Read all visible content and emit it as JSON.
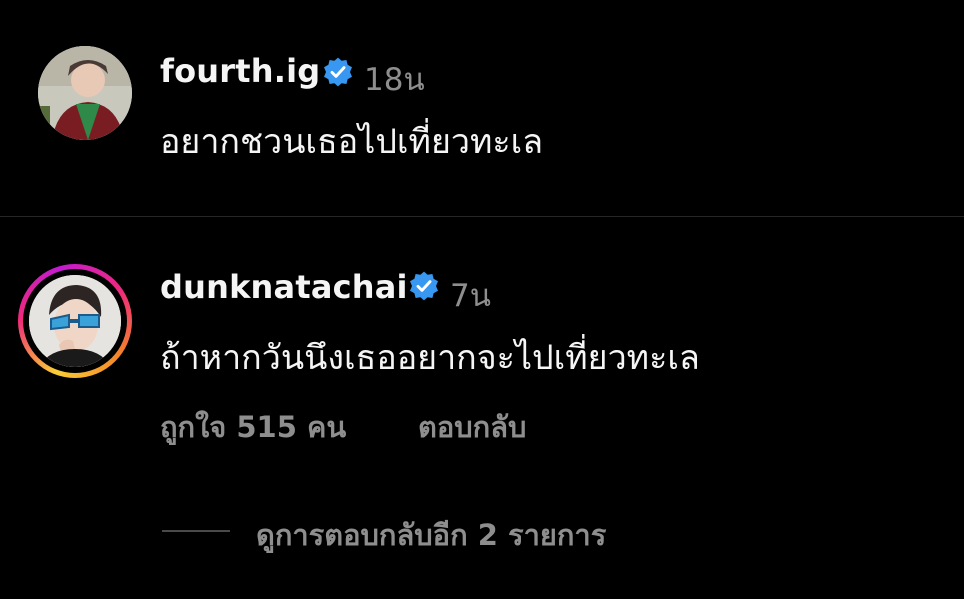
{
  "comments": [
    {
      "username": "fourth.ig",
      "verified": true,
      "time": "18น",
      "text": "อยากชวนเธอไปเที่ยวทะเล",
      "avatar_story_ring": false
    },
    {
      "username": "dunknatachai",
      "verified": true,
      "time": "7น",
      "text": "ถ้าหากวันนึงเธออยากจะไปเที่ยวทะเล",
      "avatar_story_ring": true,
      "likes_label": "ถูกใจ 515 คน",
      "reply_label": "ตอบกลับ",
      "view_replies_label": "ดูการตอบกลับอีก 2 รายการ"
    }
  ],
  "colors": {
    "background": "#000000",
    "primary_text": "#f5f5f5",
    "secondary_text": "#8e8e8e",
    "verified_blue": "#3897f0",
    "divider": "#262626"
  },
  "icons": {
    "verified": "verified-badge-icon"
  }
}
